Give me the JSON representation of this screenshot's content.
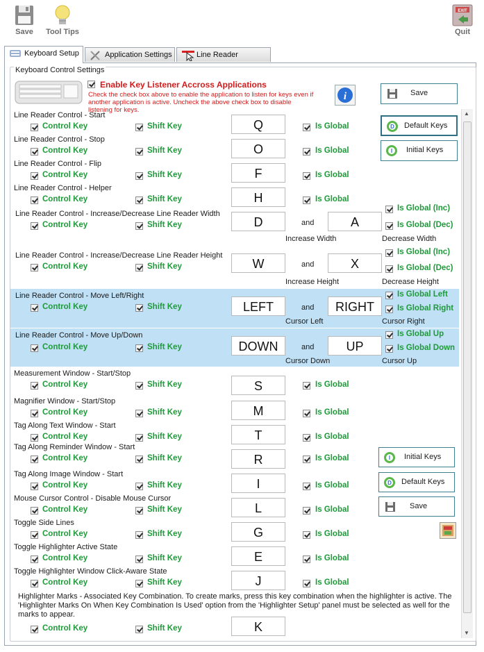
{
  "toolbar": {
    "save": "Save",
    "tooltips": "Tool Tips",
    "quit": "Quit",
    "exit_badge": "EXIT"
  },
  "tabs": [
    "Keyboard Setup",
    "Application Settings",
    "Line Reader Behavior"
  ],
  "group_title": "Keyboard Control Settings",
  "listener": {
    "title": "Enable Key Listener Accross Applications",
    "note": "Check the check box above to enable the application to listen for keys even if another application is active. Uncheck the above check box to disable listening for keys."
  },
  "labels": {
    "control": "Control Key",
    "shift": "Shift Key",
    "global": "Is Global",
    "and": "and",
    "global_inc": "Is Global (Inc)",
    "global_dec": "Is Global (Dec)",
    "global_left": "Is Global Left",
    "global_right": "Is Global Right",
    "global_up": "Is Global Up",
    "global_down": "Is Global Down",
    "inc_width": "Increase Width",
    "dec_width": "Decrease Width",
    "inc_height": "Increase Height",
    "dec_height": "Decrease Height",
    "cur_left": "Cursor Left",
    "cur_right": "Cursor Right",
    "cur_down": "Cursor Down",
    "cur_up": "Cursor Up"
  },
  "buttons": {
    "save": "Save",
    "default_keys": "Default Keys",
    "initial_keys": "Initial Keys"
  },
  "rows": {
    "start": {
      "title": "Line Reader Control - Start",
      "key": "Q"
    },
    "stop": {
      "title": "Line Reader Control - Stop",
      "key": "O"
    },
    "flip": {
      "title": "Line Reader Control - Flip",
      "key": "F"
    },
    "helper": {
      "title": "Line Reader Control - Helper",
      "key": "H"
    },
    "width": {
      "title": "Line Reader Control - Increase/Decrease Line Reader Width",
      "key1": "D",
      "key2": "A"
    },
    "height": {
      "title": "Line Reader Control - Increase/Decrease Line Reader Height",
      "key1": "W",
      "key2": "X"
    },
    "leftright": {
      "title": "Line Reader Control - Move Left/Right",
      "key1": "LEFT",
      "key2": "RIGHT"
    },
    "updown": {
      "title": "Line Reader Control - Move Up/Down",
      "key1": "DOWN",
      "key2": "UP"
    },
    "measure": {
      "title": "Measurement Window - Start/Stop",
      "key": "S"
    },
    "magnifier": {
      "title": "Magnifier Window - Start/Stop",
      "key": "M"
    },
    "tagtext": {
      "title": "Tag Along Text Window - Start",
      "key": "T"
    },
    "tagreminder": {
      "title": "Tag Along Reminder Window - Start",
      "key": "R"
    },
    "tagimage": {
      "title": "Tag Along Image Window - Start",
      "key": "I"
    },
    "mouse": {
      "title": "Mouse Cursor Control - Disable Mouse Cursor",
      "key": "L"
    },
    "sidelines": {
      "title": "Toggle Side Lines",
      "key": "G"
    },
    "highlighter": {
      "title": "Toggle Highlighter Active State",
      "key": "E"
    },
    "clickaware": {
      "title": "Toggle Highlighter Window Click-Aware State",
      "key": "J"
    },
    "marks": {
      "title": "Highlighter Marks - Associated Key Combination. To create marks, press this key combination when the highlighter is active. The 'Highlighter Marks On When Key Combination Is Used' option from the 'Highlighter Setup' panel must be selected as well for the marks to appear.",
      "key": "K"
    }
  },
  "colors": {
    "accent_green": "#1f9a3a",
    "highlight_band": "#bfe0f5",
    "warning_red": "#d41a1a"
  }
}
